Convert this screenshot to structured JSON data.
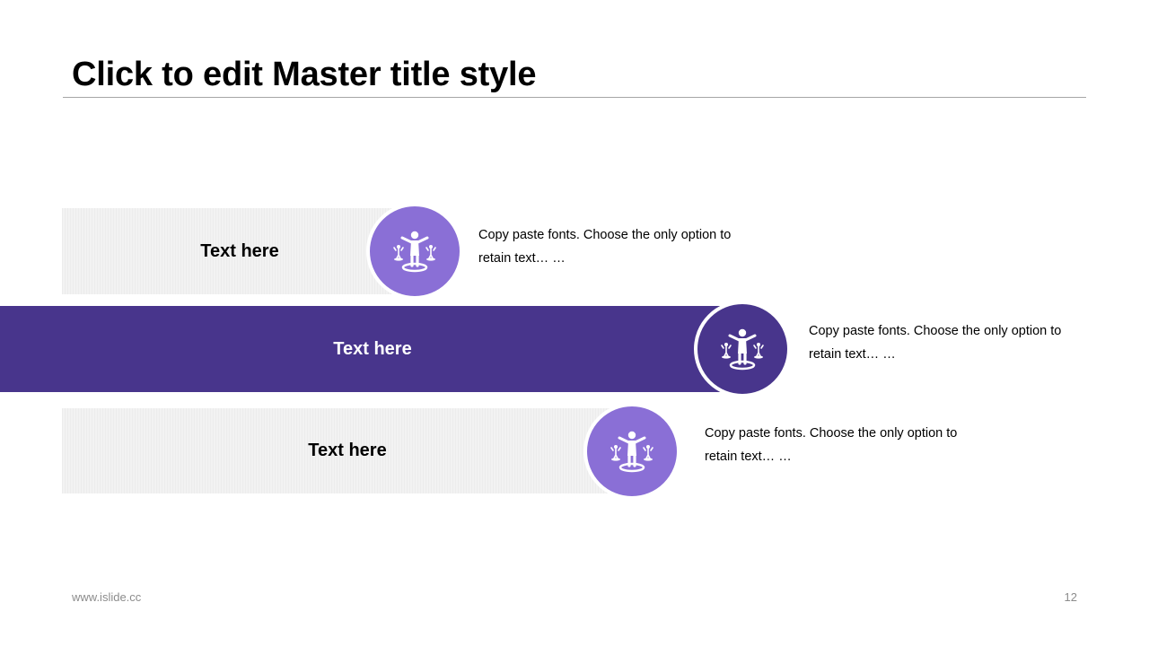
{
  "slide": {
    "title": "Click to edit Master title style"
  },
  "rows": [
    {
      "label": "Text here",
      "description": "Copy paste fonts. Choose the only option to retain text… …",
      "icon": "person-balance-icon",
      "style": "light",
      "circle_color": "#8a6fd6"
    },
    {
      "label": "Text here",
      "description": "Copy paste fonts. Choose the only option to retain text… …",
      "icon": "person-balance-icon",
      "style": "dark",
      "circle_color": "#48358c"
    },
    {
      "label": "Text here",
      "description": "Copy paste fonts. Choose the only option to retain text… …",
      "icon": "person-balance-icon",
      "style": "light",
      "circle_color": "#8a6fd6"
    }
  ],
  "colors": {
    "accent_light": "#8a6fd6",
    "accent_dark": "#48358c",
    "bar_light": "#f2f2f2"
  },
  "footer": {
    "url": "www.islide.cc",
    "page_number": "12"
  }
}
